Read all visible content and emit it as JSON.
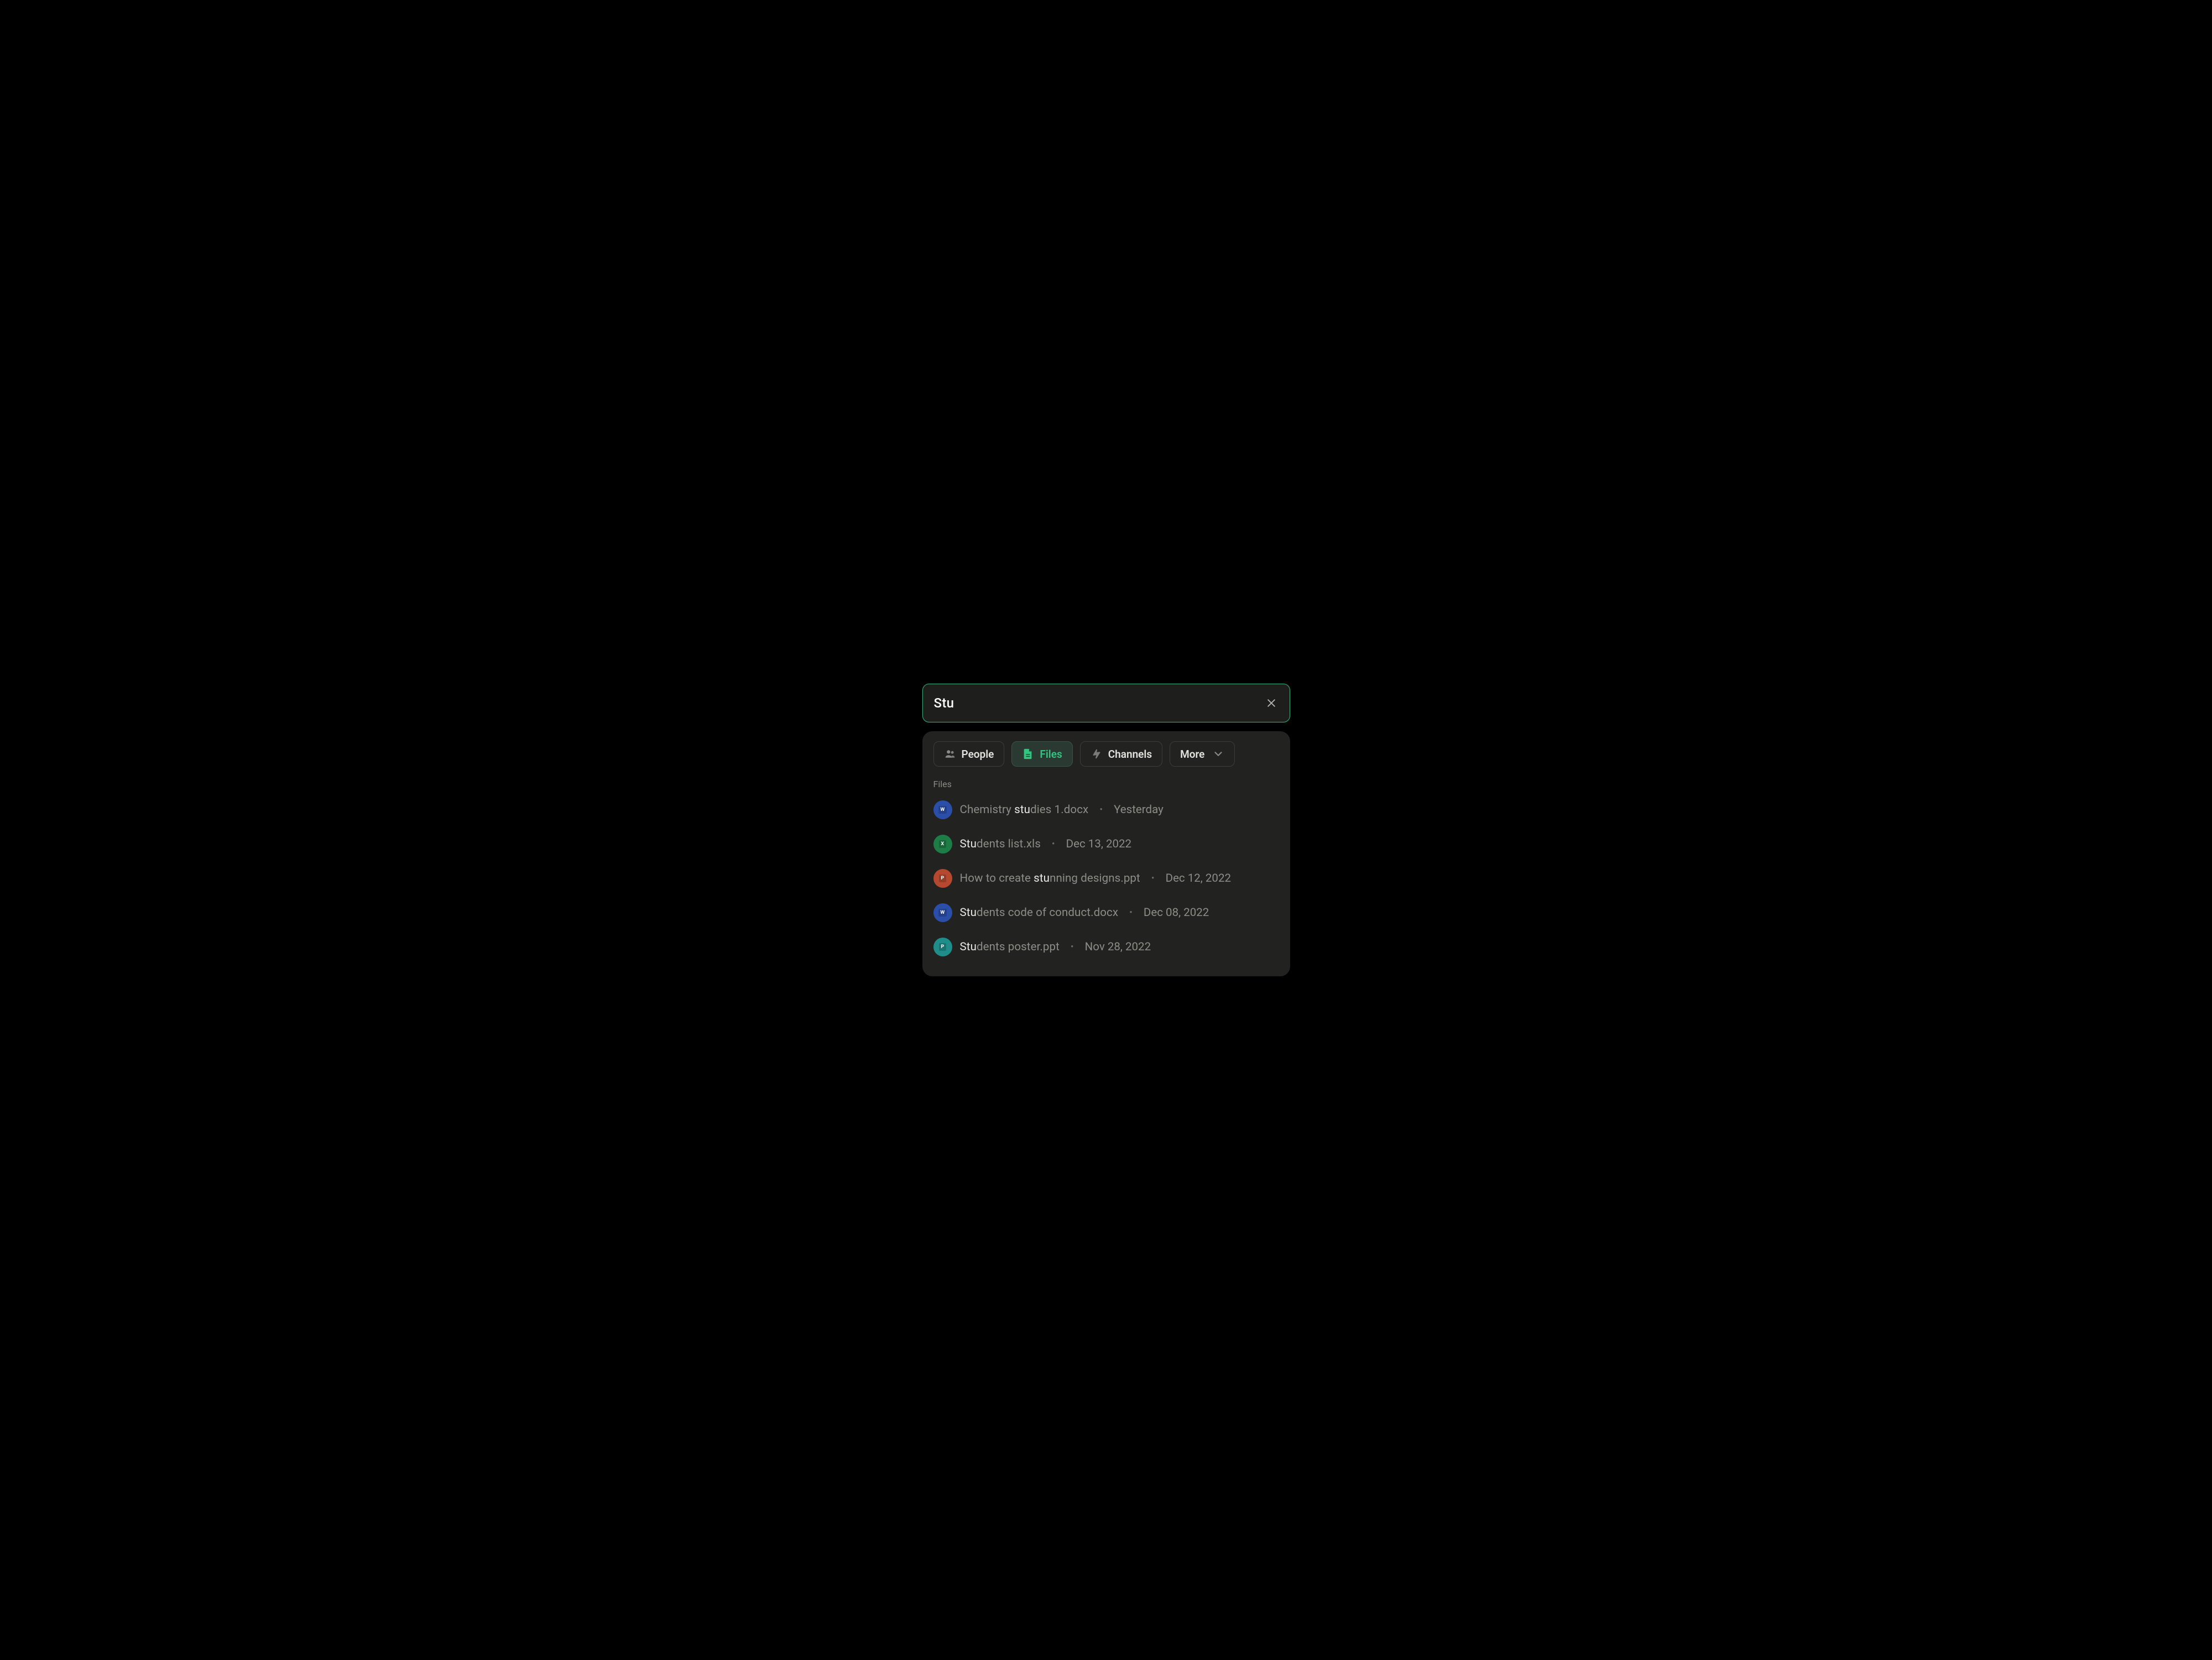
{
  "search": {
    "query": "Stu",
    "placeholder": ""
  },
  "filters": {
    "items": [
      {
        "label": "People",
        "active": false
      },
      {
        "label": "Files",
        "active": true
      },
      {
        "label": "Channels",
        "active": false
      },
      {
        "label": "More",
        "active": false,
        "dropdown": true
      }
    ]
  },
  "section_label": "Files",
  "results": [
    {
      "type": "word",
      "name_pre": "Chemistry ",
      "name_match": "stu",
      "name_post": "dies 1.docx",
      "date": "Yesterday"
    },
    {
      "type": "excel",
      "name_pre": "",
      "name_match": "Stu",
      "name_post": "dents list.xls",
      "date": "Dec 13, 2022"
    },
    {
      "type": "ppt",
      "name_pre": "How to create ",
      "name_match": "stu",
      "name_post": "nning designs.ppt",
      "date": "Dec 12, 2022"
    },
    {
      "type": "word",
      "name_pre": "",
      "name_match": "Stu",
      "name_post": "dents code of conduct.docx",
      "date": "Dec 08, 2022"
    },
    {
      "type": "pub",
      "name_pre": "",
      "name_match": "Stu",
      "name_post": "dents poster.ppt",
      "date": "Nov 28, 2022"
    }
  ],
  "icon_labels": {
    "word": "W",
    "excel": "X",
    "ppt": "P",
    "pub": "P"
  }
}
